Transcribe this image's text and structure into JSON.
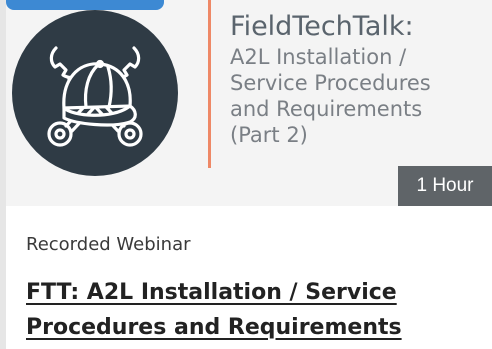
{
  "card": {
    "thumbnail": {
      "brand": "FieldTechTalk:",
      "subtitle_lines": [
        "A2L Installation /",
        "Service Procedures",
        "and Requirements",
        "(Part 2)"
      ],
      "logo_icon": "tech-cap-wrenches-icon",
      "duration": "1 Hour"
    },
    "content_type": "Recorded Webinar",
    "title_lines": [
      "FTT: A2L Installation / Service",
      "Procedures and Requirements"
    ]
  },
  "colors": {
    "logo_circle": "#2f3b45",
    "accent_line": "#ee8866",
    "category_tab": "#3d89d3",
    "badge_bg": "#5f6468",
    "title_text": "#222222"
  }
}
